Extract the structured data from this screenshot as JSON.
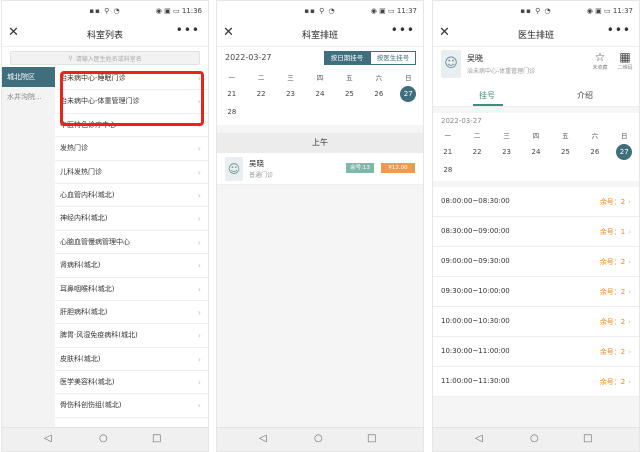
{
  "status": {
    "time1": "11:36",
    "time2": "11:37",
    "time3": "11:37",
    "indicators": "▪▪ ⚲ ◔",
    "right_icons": "◉ ▣ ▭"
  },
  "panel1": {
    "title": "科室列表",
    "search_placeholder": "请输入医生姓名或科室名",
    "sidebar": [
      {
        "label": "城北院区",
        "active": true
      },
      {
        "label": "水井沟院...",
        "active": false
      }
    ],
    "departments": [
      "治未病中心-睡眠门诊",
      "治未病中心-体重管理门诊",
      "中医特色诊疗中心",
      "发热门诊",
      "儿科发热门诊",
      "心血管内科(城北)",
      "神经内科(城北)",
      "心脑血管慢病管理中心",
      "肾病科(城北)",
      "耳鼻咽喉科(城北)",
      "肝胆病科(城北)",
      "脾胃·风湿免疫病科(城北)",
      "皮肤科(城北)",
      "医学美容科(城北)",
      "骨伤科创伤组(城北)"
    ]
  },
  "panel2": {
    "title": "科室排班",
    "date": "2022-03-27",
    "btn_by_date": "按日期挂号",
    "btn_by_doctor": "按医生挂号",
    "weekdays": [
      "一",
      "二",
      "三",
      "四",
      "五",
      "六",
      "日"
    ],
    "week1": [
      "21",
      "22",
      "23",
      "24",
      "25",
      "26",
      "27"
    ],
    "week2": [
      "28"
    ],
    "session": "上午",
    "doctor": {
      "name": "吴晓",
      "type": "普通门诊",
      "remaining": "余号:13",
      "price": "¥12.00"
    }
  },
  "panel3": {
    "title": "医生排班",
    "doctor_name": "吴晓",
    "doctor_dept": "治未病中心-体重管理门诊",
    "fav_label": "未收藏",
    "qr_label": "二维码",
    "tab_register": "挂号",
    "tab_intro": "介绍",
    "date": "2022-03-27",
    "weekdays": [
      "一",
      "二",
      "三",
      "四",
      "五",
      "六",
      "日"
    ],
    "week1": [
      "21",
      "22",
      "23",
      "24",
      "25",
      "26",
      "27"
    ],
    "week2": [
      "28"
    ],
    "slots": [
      {
        "time": "08:00:00~08:30:00",
        "rem": "余号：2"
      },
      {
        "time": "08:30:00~09:00:00",
        "rem": "余号：1"
      },
      {
        "time": "09:00:00~09:30:00",
        "rem": "余号：2"
      },
      {
        "time": "09:30:00~10:00:00",
        "rem": "余号：2"
      },
      {
        "time": "10:00:00~10:30:00",
        "rem": "余号：2"
      },
      {
        "time": "10:30:00~11:00:00",
        "rem": "余号：2"
      },
      {
        "time": "11:00:00~11:30:00",
        "rem": "余号：2"
      }
    ]
  },
  "colors": {
    "accent": "#3f6e7c",
    "highlight": "#e8241a",
    "orange": "#ee9a50",
    "green": "#7cb9a9"
  }
}
